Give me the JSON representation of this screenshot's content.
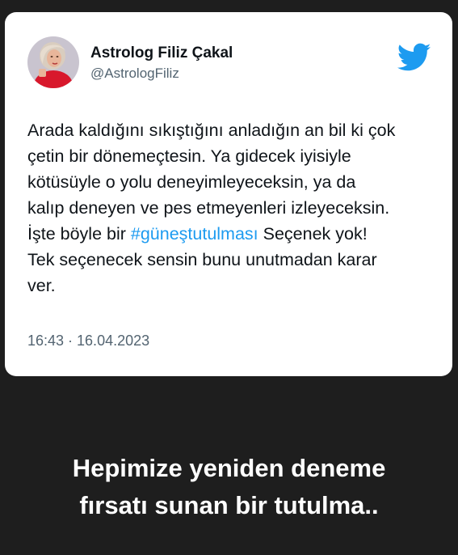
{
  "tweet": {
    "author_name": "Astrolog Filiz Çakal",
    "author_handle": "@AstrologFiliz",
    "text_lines": [
      {
        "before": "Arada kaldığını sıkıştığını anladığın an bil ki çok"
      },
      {
        "before": "çetin bir dönemeçtesin. Ya gidecek iyisiyle"
      },
      {
        "before": "kötüsüyle o yolu deneyimleyeceksin, ya da"
      },
      {
        "before": "kalıp deneyen ve pes etmeyenleri izleyeceksin."
      },
      {
        "before": "İşte böyle bir ",
        "hashtag": "#güneştutulması",
        "after": " Seçenek yok!"
      },
      {
        "before": "Tek seçenecek sensin bunu unutmadan karar"
      },
      {
        "before": "ver."
      }
    ],
    "timestamp": "16:43 · 16.04.2023",
    "hashtag_color": "#1d9bf0",
    "twitter_brand_color": "#1d9bf0"
  },
  "caption": {
    "line1": "Hepimize yeniden deneme",
    "line2": "fırsatı sunan bir tutulma.."
  },
  "icons": {
    "brand": "twitter-bird-icon",
    "avatar": "avatar-photo"
  }
}
